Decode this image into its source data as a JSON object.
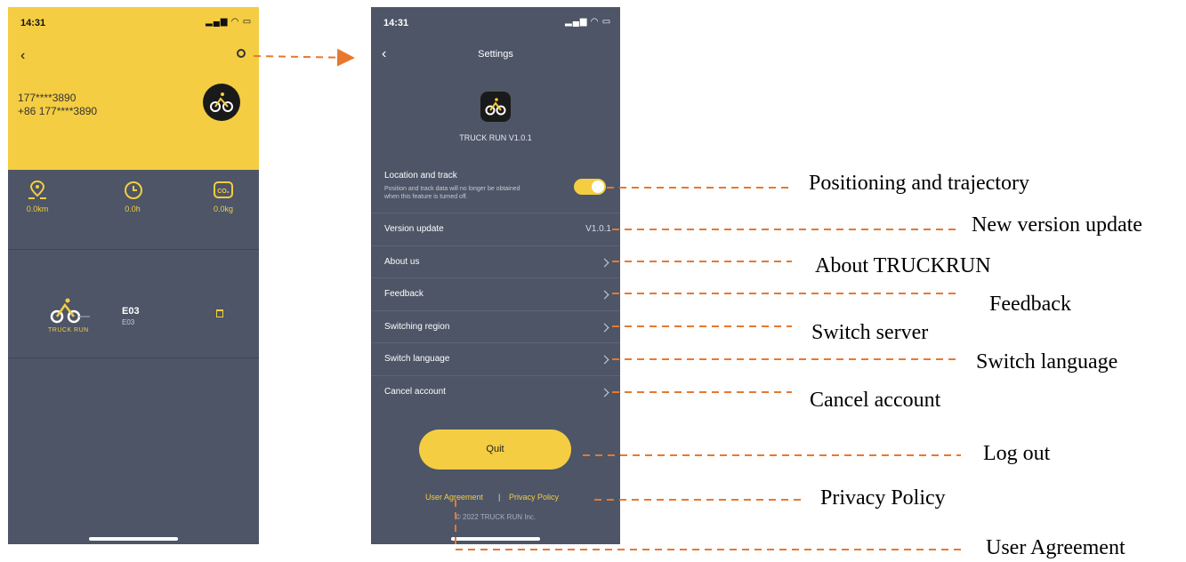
{
  "phone1": {
    "status_time": "14:31",
    "user_masked": "177****3890",
    "user_phone": "+86 177****3890",
    "stats": [
      {
        "icon": "location-pin-icon",
        "label": "0.0km"
      },
      {
        "icon": "clock-icon",
        "label": "0.0h"
      },
      {
        "icon": "co2-icon",
        "label": "0.0kg"
      }
    ],
    "device": {
      "name": "E03",
      "sub": "E03",
      "brand": "TRUCK RUN"
    }
  },
  "phone2": {
    "status_time": "14:31",
    "title": "Settings",
    "app_version": "TRUCK RUN V1.0.1",
    "location": {
      "label": "Location and track",
      "desc_line1": "Position and track data will no longer be obtained",
      "desc_line2": "when this feature is turned off.",
      "enabled": true
    },
    "rows": [
      {
        "label": "Version update",
        "value": "V1.0.1"
      },
      {
        "label": "About us"
      },
      {
        "label": "Feedback"
      },
      {
        "label": "Switching region"
      },
      {
        "label": "Switch language"
      },
      {
        "label": "Cancel account"
      }
    ],
    "quit_label": "Quit",
    "user_agreement": "User Agreement",
    "separator": "|",
    "privacy_policy": "Privacy Policy",
    "copyright": "© 2022 TRUCK RUN Inc."
  },
  "annotations": {
    "positioning": "Positioning and trajectory",
    "version": "New version update",
    "about": "About TRUCKRUN",
    "feedback": "Feedback",
    "switch_server": "Switch server",
    "switch_language": "Switch language",
    "cancel_account": "Cancel account",
    "log_out": "Log out",
    "privacy": "Privacy Policy",
    "user_agreement": "User Agreement"
  },
  "colors": {
    "accent": "#f4cd42",
    "panel": "#4d5566",
    "arrow": "#e8782f"
  }
}
